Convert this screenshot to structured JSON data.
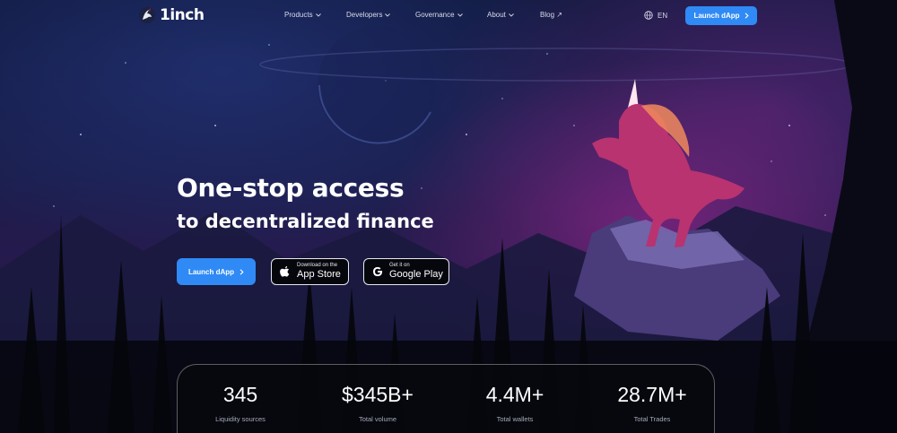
{
  "header": {
    "logo_text": "1inch",
    "nav": [
      {
        "label": "Products",
        "has_dropdown": true
      },
      {
        "label": "Developers",
        "has_dropdown": true
      },
      {
        "label": "Governance",
        "has_dropdown": true
      },
      {
        "label": "About",
        "has_dropdown": true
      },
      {
        "label": "Blog ↗",
        "has_dropdown": false
      }
    ],
    "language": "EN",
    "launch_label": "Launch dApp"
  },
  "hero": {
    "title": "One-stop access",
    "subtitle": "to decentralized finance",
    "launch_label": "Launch dApp",
    "app_store": {
      "small": "Download on the",
      "big": "App Store"
    },
    "google_play": {
      "small": "Get it on",
      "big": "Google Play"
    }
  },
  "stats": [
    {
      "value": "345",
      "label": "Liquidity sources"
    },
    {
      "value": "$345B+",
      "label": "Total volume"
    },
    {
      "value": "4.4M+",
      "label": "Total wallets"
    },
    {
      "value": "28.7M+",
      "label": "Total Trades"
    }
  ],
  "colors": {
    "accent": "#2f8af5",
    "background": "#0b1022",
    "unicorn": "#c23a7a",
    "mane": "#f08a5d"
  },
  "icons": [
    "1inch-logo-icon",
    "chevron-down-icon",
    "globe-icon",
    "chevron-right-icon",
    "apple-icon",
    "google-play-icon"
  ]
}
